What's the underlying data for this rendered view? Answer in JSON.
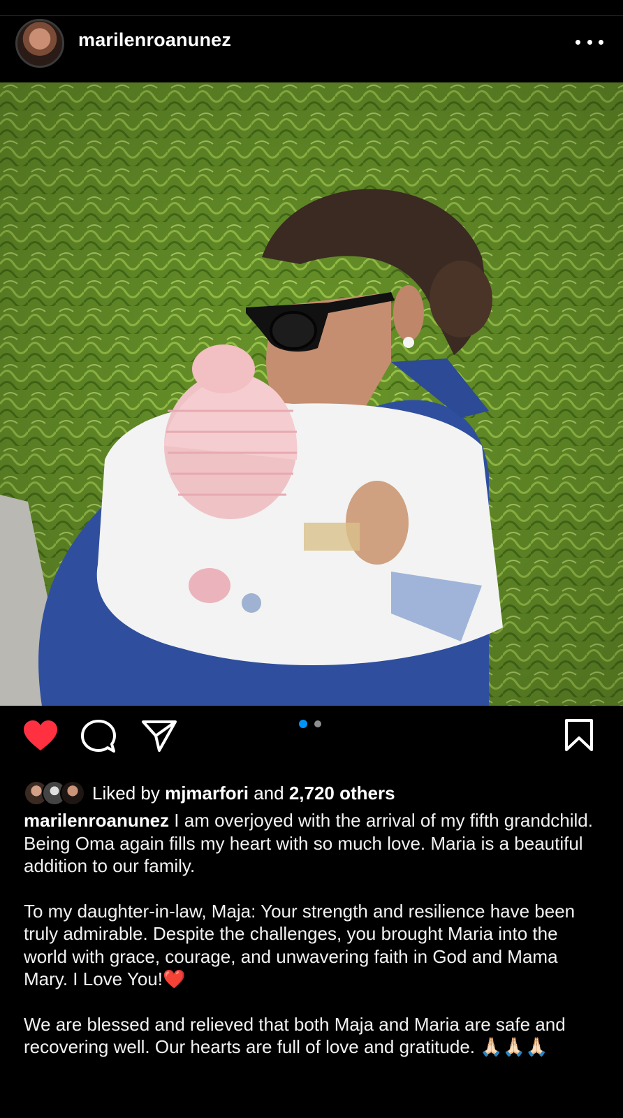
{
  "post": {
    "username": "marilenroanunez",
    "more_icon": "more-horizontal-icon"
  },
  "actions": {
    "like_icon": "heart-filled-icon",
    "comment_icon": "comment-icon",
    "share_icon": "send-icon",
    "save_icon": "bookmark-icon",
    "carousel": {
      "total": 2,
      "active": 1
    }
  },
  "likes": {
    "prefix": "Liked by ",
    "user": "mjmarfori",
    "joiner": " and ",
    "others": "2,720 others"
  },
  "caption": {
    "username": "marilenroanunez",
    "paragraph1": " I am overjoyed with the arrival of my fifth grandchild. Being Oma again fills my heart with so much love. Maria is a beautiful addition to our family.",
    "paragraph2": "To my daughter-in-law, Maja: Your strength and resilience have been truly admirable. Despite the challenges, you brought Maria into the world with grace, courage, and unwavering faith in God and Mama Mary. I Love You!❤️",
    "paragraph3": "We are blessed and relieved that both Maja and Maria are safe and recovering well. Our hearts are full of love and gratitude. 🙏🏻🙏🏻🙏🏻"
  },
  "colors": {
    "background": "#000000",
    "like_active": "#ff3040",
    "carousel_active": "#0095f6",
    "carousel_inactive": "#8e8e8e"
  }
}
